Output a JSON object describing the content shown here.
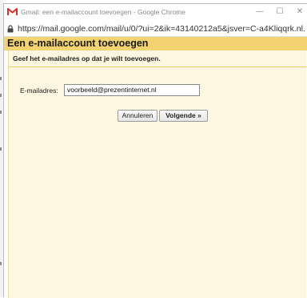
{
  "window": {
    "title": "Gmail: een e-mailaccount toevoegen - Google Chrome",
    "url": "https://mail.google.com/mail/u/0/?ui=2&ik=43140212a5&jsver=C-a4Kliqqrk.nl...",
    "minimize_glyph": "—",
    "maximize_glyph": "☐",
    "close_glyph": "✕"
  },
  "dialog": {
    "title": "Een e-mailaccount toevoegen",
    "instruction": "Geef het e-mailadres op dat je wilt toevoegen.",
    "email_label": "E-mailadres:",
    "email_value": "voorbeeld@prezentinternet.nl",
    "cancel_label": "Annuleren",
    "next_label": "Volgende »"
  },
  "colors": {
    "header": "#f3d470",
    "body": "#fdf6e0",
    "separator": "#f0c95a",
    "gmail_red": "#d93025"
  },
  "icons": [
    "gmail-logo-icon",
    "lock-icon",
    "minimize-icon",
    "maximize-icon",
    "close-icon"
  ]
}
